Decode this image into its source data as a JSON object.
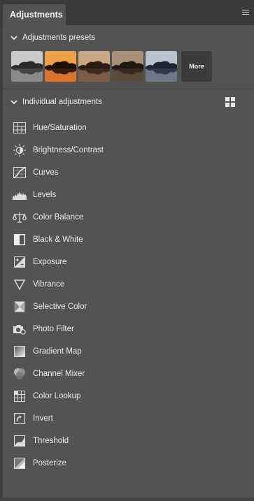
{
  "panel": {
    "tab_title": "Adjustments"
  },
  "presets_section": {
    "title": "Adjustments presets",
    "thumbnails": [
      "preset-bw",
      "preset-orange",
      "preset-warm",
      "preset-sepia",
      "preset-cool"
    ],
    "more_label": "More"
  },
  "individual_section": {
    "title": "Individual adjustments",
    "items": [
      {
        "label": "Hue/Saturation",
        "icon": "hue-saturation-icon"
      },
      {
        "label": "Brightness/Contrast",
        "icon": "brightness-contrast-icon"
      },
      {
        "label": "Curves",
        "icon": "curves-icon"
      },
      {
        "label": "Levels",
        "icon": "levels-icon"
      },
      {
        "label": "Color Balance",
        "icon": "color-balance-icon"
      },
      {
        "label": "Black & White",
        "icon": "black-white-icon"
      },
      {
        "label": "Exposure",
        "icon": "exposure-icon"
      },
      {
        "label": "Vibrance",
        "icon": "vibrance-icon"
      },
      {
        "label": "Selective Color",
        "icon": "selective-color-icon"
      },
      {
        "label": "Photo Filter",
        "icon": "photo-filter-icon"
      },
      {
        "label": "Gradient Map",
        "icon": "gradient-map-icon"
      },
      {
        "label": "Channel Mixer",
        "icon": "channel-mixer-icon"
      },
      {
        "label": "Color Lookup",
        "icon": "color-lookup-icon"
      },
      {
        "label": "Invert",
        "icon": "invert-icon"
      },
      {
        "label": "Threshold",
        "icon": "threshold-icon"
      },
      {
        "label": "Posterize",
        "icon": "posterize-icon"
      }
    ]
  },
  "colors": {
    "panel_bg": "#535353",
    "tabbar_bg": "#3a3a3a",
    "text": "#ececec"
  }
}
